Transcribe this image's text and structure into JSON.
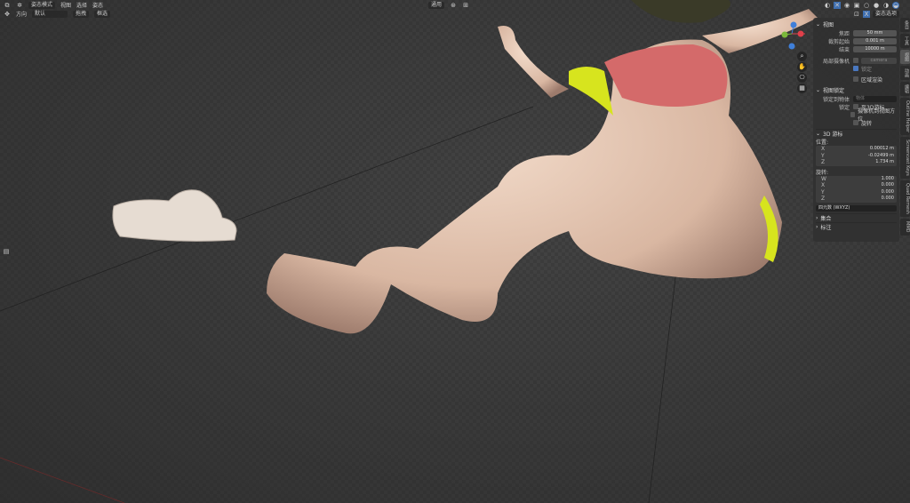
{
  "header": {
    "row1": [
      "姿态模式",
      "视图",
      "选择",
      "姿态"
    ],
    "orientation_label": "方向",
    "orientation_value": "默认",
    "drag_label": "拖拽",
    "select_label": "框选",
    "transform_orientation": "通用",
    "pose_options": "姿态选项"
  },
  "npanel": {
    "view_section": "视图",
    "focal_label": "焦距",
    "focal_value": "50 mm",
    "clip_start_label": "裁剪起始",
    "clip_start_value": "0.001 m",
    "clip_end_label": "结束",
    "clip_end_value": "10000 m",
    "local_camera_label": "局部摄像机",
    "local_camera_value": "camera",
    "lock_label_small": "锁定",
    "region_render": "区域渲染",
    "view_lock_section": "视图锁定",
    "lock_to_object_label": "锁定到物体",
    "lock_to_object_placeholder": "物体",
    "lock_label": "锁定",
    "lock_3d_cursor": "至3D游标",
    "lock_camera_to_view": "摄像机到视图方位",
    "rotation_lock": "旋转",
    "cursor_section": "3D 游标",
    "location_label": "位置:",
    "loc": [
      {
        "axis": "X",
        "value": "0.00012 m"
      },
      {
        "axis": "Y",
        "value": "-0.02499 m"
      },
      {
        "axis": "Z",
        "value": "1.734 m"
      }
    ],
    "rotation_label": "旋转:",
    "rot": [
      {
        "axis": "W",
        "value": "1.000"
      },
      {
        "axis": "X",
        "value": "0.000"
      },
      {
        "axis": "Y",
        "value": "0.000"
      },
      {
        "axis": "Z",
        "value": "0.000"
      }
    ],
    "rotation_mode": "四元数 (WXYZ)",
    "collections_section": "集合",
    "annotations_section": "标注"
  },
  "tabs": [
    "条目",
    "工具",
    "视图",
    "动画",
    "编辑",
    "Outline Helper",
    "Screencast Keys",
    "Quad Remesh",
    "MMD"
  ],
  "colors": {
    "x_axis": "#e0404a",
    "y_axis": "#7ab83a",
    "z_axis": "#3f7fd9",
    "accent": "#4a78c0",
    "bikini": "#d7e41e",
    "skin": "#e9cdb8"
  }
}
